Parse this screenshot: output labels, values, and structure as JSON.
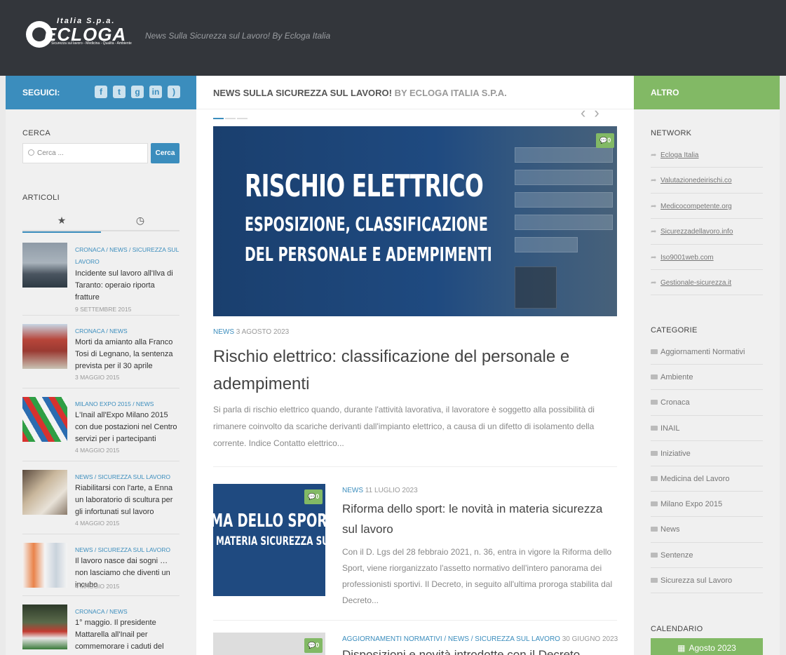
{
  "header": {
    "logo_top": "Italia S.p.a.",
    "logo_brand": "ECLOGA",
    "logo_tag": "Sicurezza sul lavoro - Medicina - Qualità - Ambiente",
    "description": "News Sulla Sicurezza sul Lavoro! By Ecloga Italia"
  },
  "left": {
    "follow_label": "SEGUICI:",
    "social_icons": [
      "facebook-icon",
      "twitter-icon",
      "google-plus-icon",
      "linkedin-icon",
      "rss-icon"
    ],
    "search_title": "CERCA",
    "search_placeholder": "Cerca ...",
    "search_button": "Cerca",
    "articles_title": "ARTICOLI",
    "tab_icons": [
      "star-icon",
      "clock-icon"
    ],
    "articles": [
      {
        "meta": "CRONACA / NEWS / SICUREZZA SUL LAVORO",
        "title": "Incidente sul lavoro all'Ilva di Taranto: operaio riporta fratture",
        "date": "9 SETTEMBRE 2015"
      },
      {
        "meta": "CRONACA / NEWS",
        "title": "Morti da amianto alla Franco Tosi di Legnano, la sentenza prevista per il 30 aprile",
        "date": "3 MAGGIO 2015"
      },
      {
        "meta": "MILANO EXPO 2015 / NEWS",
        "title": "L'Inail all'Expo Milano 2015 con due postazioni nel Centro servizi per i partecipanti",
        "date": "4 MAGGIO 2015"
      },
      {
        "meta": "NEWS / SICUREZZA SUL LAVORO",
        "title": "Riabilitarsi con l'arte, a Enna un laboratorio di scultura per gli infortunati sul lavoro",
        "date": "4 MAGGIO 2015"
      },
      {
        "meta": "NEWS / SICUREZZA SUL LAVORO",
        "title": "Il lavoro nasce dai sogni … non lasciamo che diventi un incubo",
        "date": "4 MAGGIO 2015"
      },
      {
        "meta": "CRONACA / NEWS",
        "title": "1° maggio. Il presidente Mattarella all'Inail per commemorare i caduti del",
        "date": ""
      }
    ]
  },
  "main": {
    "heading_a": "NEWS SULLA SICUREZZA SUL LAVORO!",
    "heading_b": "BY ECLOGA ITALIA S.P.A.",
    "feature": {
      "line1": "RISCHIO ELETTRICO",
      "line2": "ESPOSIZIONE, CLASSIFICAZIONE",
      "line3": "DEL PERSONALE E ADEMPIMENTI",
      "comments": "0"
    },
    "post1": {
      "category": "NEWS",
      "date": "3 AGOSTO 2023",
      "title": "Rischio elettrico: classificazione del personale e adempimenti",
      "excerpt": "Si parla di rischio elettrico quando, durante l'attività lavorativa, il lavoratore è soggetto alla possibilità di rimanere coinvolto da scariche derivanti dall'impianto elettrico, a causa di un difetto di isolamento della corrente. Indice Contatto elettrico..."
    },
    "post2": {
      "img_line1": "MA DELLO SPORT",
      "img_line2": "MATERIA SICUREZZA SU",
      "comments": "0",
      "category": "NEWS",
      "date": "11 LUGLIO 2023",
      "title": "Riforma dello sport: le novità in materia sicurezza sul lavoro",
      "excerpt": "Con il D. Lgs del 28 febbraio 2021, n. 36, entra in vigore la Riforma dello Sport, viene riorganizzato  l'assetto normativo dell'intero panorama dei professionisti sportivi. Il Decreto, in seguito all'ultima proroga stabilita dal Decreto..."
    },
    "post3": {
      "comments": "0",
      "categories": "AGGIORNAMENTI NORMATIVI / NEWS / SICUREZZA SUL LAVORO",
      "date": "30 GIUGNO 2023",
      "title": "Disposizioni e novità introdotte con il Decreto"
    }
  },
  "right": {
    "altro_label": "ALTRO",
    "network_title": "NETWORK",
    "network": [
      "Ecloga Italia",
      "Valutazionedeirischi.co",
      "Medicocompetente.org",
      "Sicurezzadellavoro.info",
      "Iso9001web.com",
      "Gestionale-sicurezza.it"
    ],
    "categories_title": "CATEGORIE",
    "categories": [
      "Aggiornamenti Normativi",
      "Ambiente",
      "Cronaca",
      "INAIL",
      "Iniziative",
      "Medicina del Lavoro",
      "Milano Expo 2015",
      "News",
      "Sentenze",
      "Sicurezza sul Lavoro"
    ],
    "calendar_title": "CALENDARIO",
    "calendar_month": "Agosto 2023"
  },
  "colors": {
    "header": "#33363b",
    "blue": "#3b8dbd",
    "green": "#82b965"
  }
}
